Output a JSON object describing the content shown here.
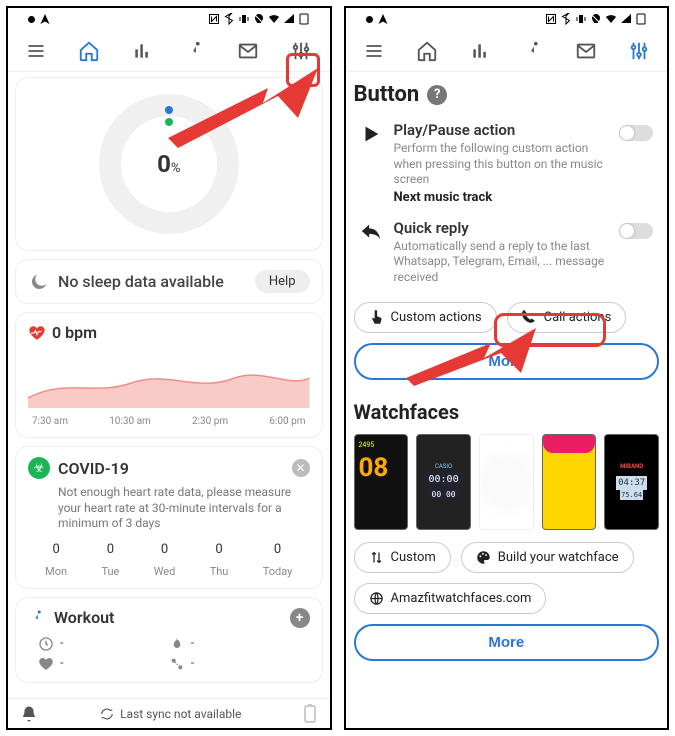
{
  "left": {
    "donut": {
      "value": "0",
      "unit": "%"
    },
    "sleep": {
      "label": "No sleep data available",
      "help": "Help"
    },
    "bpm": {
      "title": "0 bpm",
      "ticks": [
        "7:30 am",
        "10:30 am",
        "2:30 pm",
        "6:00 pm"
      ]
    },
    "covid": {
      "title": "COVID-19",
      "desc": "Not enough heart rate data, please measure your heart rate at 30-minute intervals for a minimum of 3 days",
      "values": [
        "0",
        "0",
        "0",
        "0",
        "0"
      ],
      "days": [
        "Mon",
        "Tue",
        "Wed",
        "Thu",
        "Today"
      ]
    },
    "workout": {
      "title": "Workout",
      "dash": "-"
    },
    "sync": "Last sync not available"
  },
  "right": {
    "button_section": "Button",
    "play": {
      "title": "Play/Pause action",
      "desc": "Perform the following custom action when pressing this button on the music screen",
      "value": "Next music track"
    },
    "reply": {
      "title": "Quick reply",
      "desc": "Automatically send a reply to the last Whatsapp, Telegram, Email, ... message received"
    },
    "chip_custom": "Custom actions",
    "chip_call": "Call actions",
    "more": "More",
    "wf_section": "Watchfaces",
    "chip_custom_wf": "Custom",
    "chip_build": "Build your watchface",
    "chip_amazfit": "Amazfitwatchfaces.com"
  }
}
